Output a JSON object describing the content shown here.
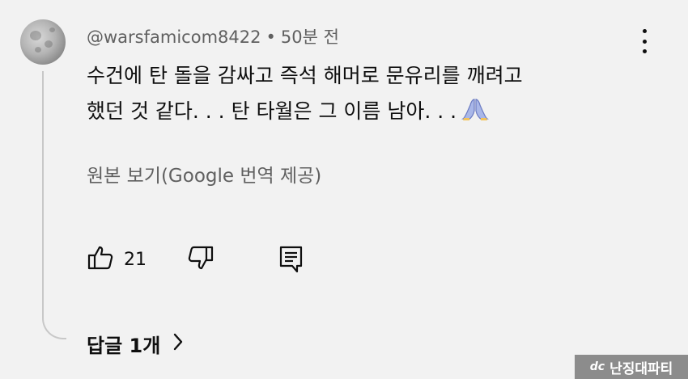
{
  "comment": {
    "author": "@warsfamicom8422",
    "separator": "•",
    "timestamp": "50분 전",
    "text_line1": "수건에 탄 돌을 감싸고 즉석 해머로 문유리를 깨려고",
    "text_line2": "했던 것 같다. . . 탄 타월은 그 이름 남아. . .",
    "emoji_icon": "folded-hands-icon",
    "translation_toggle": "원본 보기(Google 번역 제공)",
    "like_count": "21",
    "replies_label": "답글 1개"
  },
  "watermark": {
    "logo": "dc",
    "text": "난징대파티"
  },
  "colors": {
    "background": "#f2f2f2",
    "text_primary": "#0f0f0f",
    "text_secondary": "#606060",
    "thread_line": "#c8c8c8"
  }
}
